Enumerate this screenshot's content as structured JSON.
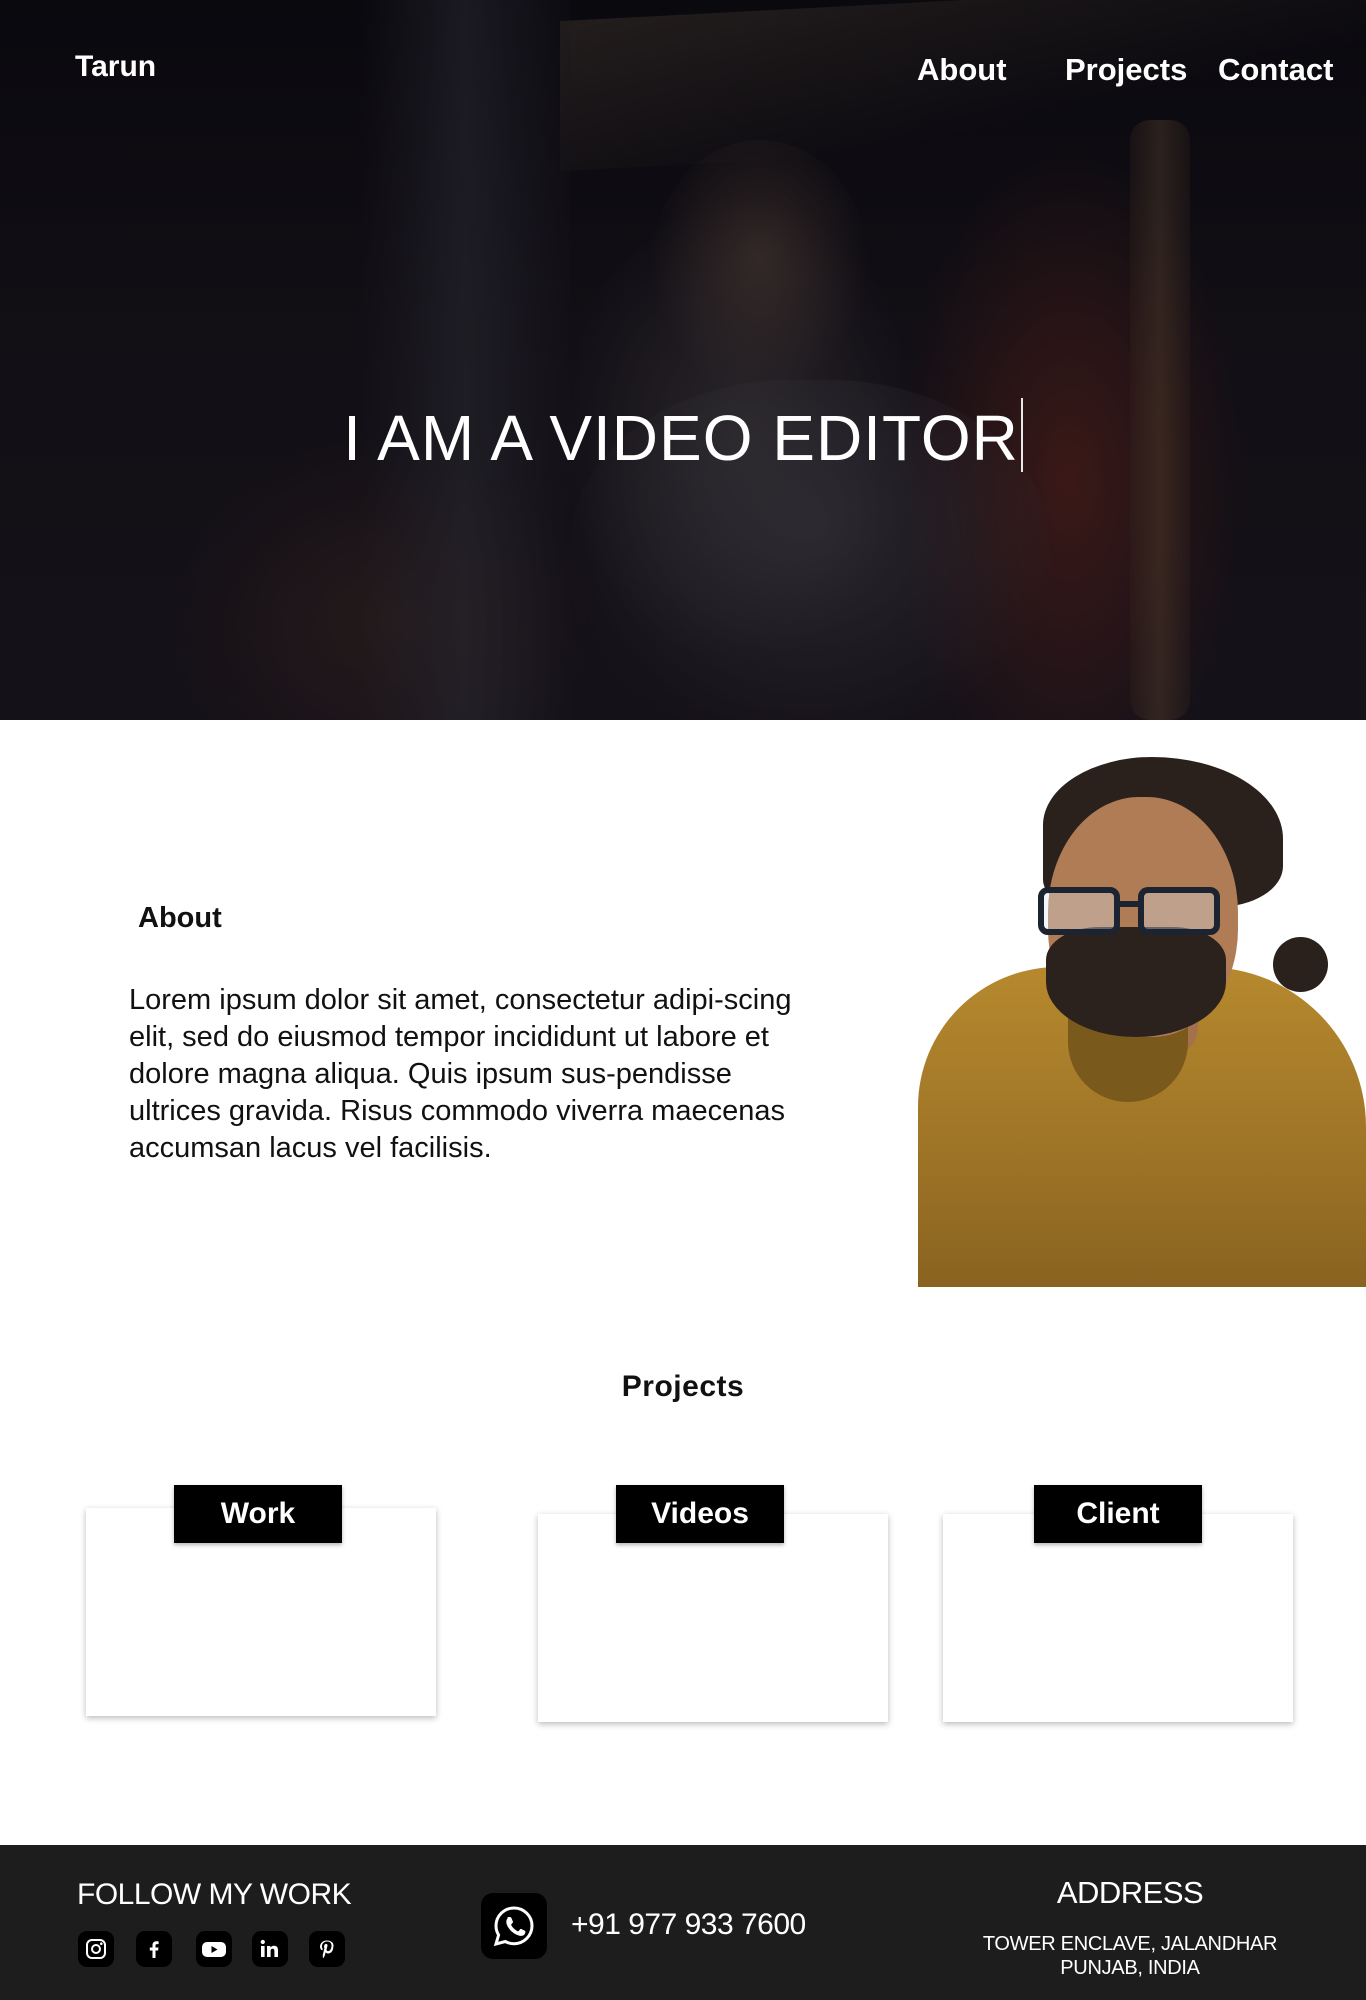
{
  "header": {
    "brand": "Tarun",
    "nav": [
      {
        "label": "About"
      },
      {
        "label": "Projects"
      },
      {
        "label": "Contact"
      }
    ]
  },
  "hero": {
    "title": "I AM A VIDEO EDITOR"
  },
  "about": {
    "heading": "About",
    "text": "Lorem ipsum dolor sit amet, consectetur adipi-scing elit, sed do eiusmod tempor incididunt ut labore et dolore magna aliqua. Quis ipsum sus-pendisse ultrices gravida. Risus commodo viverra maecenas accumsan lacus vel facilisis."
  },
  "projects": {
    "heading": "Projects",
    "cards": [
      {
        "label": "Work"
      },
      {
        "label": "Videos"
      },
      {
        "label": "Client"
      }
    ]
  },
  "footer": {
    "follow_label": "FOLLOW MY WORK",
    "social_icons": [
      "instagram-icon",
      "facebook-icon",
      "youtube-icon",
      "linkedin-icon",
      "pinterest-icon"
    ],
    "whatsapp_icon": "whatsapp-icon",
    "phone": "+91 977 933 7600",
    "address_title": "ADDRESS",
    "address_lines": [
      "TOWER ENCLAVE, JALANDHAR",
      "PUNJAB, INDIA"
    ]
  },
  "colors": {
    "footer_bg": "#1d1d1d",
    "tag_bg": "#000000",
    "hero_text": "#ffffff"
  }
}
